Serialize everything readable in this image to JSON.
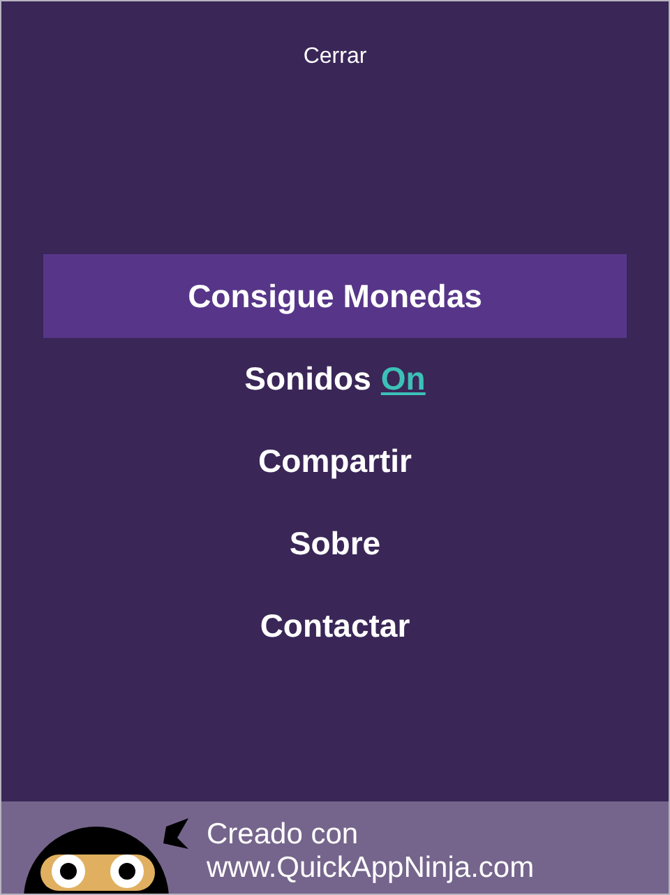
{
  "close_label": "Cerrar",
  "menu": [
    {
      "kind": "item",
      "label": "Consigue Monedas",
      "selected": true
    },
    {
      "kind": "toggle",
      "label": "Sonidos",
      "value": "On",
      "on": true,
      "selected": false
    },
    {
      "kind": "item",
      "label": "Compartir",
      "selected": false
    },
    {
      "kind": "item",
      "label": "Sobre",
      "selected": false
    },
    {
      "kind": "item",
      "label": "Contactar",
      "selected": false
    }
  ],
  "footer": {
    "line_1": "Creado con",
    "line_2": "www.QuickAppNinja.com"
  }
}
